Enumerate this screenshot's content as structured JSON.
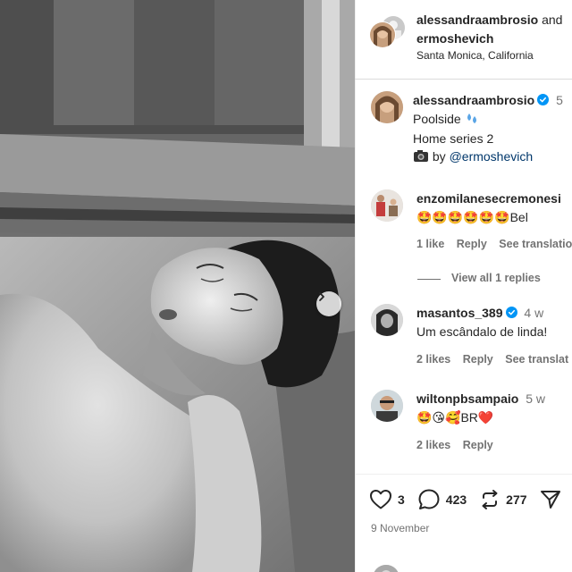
{
  "post": {
    "image_alt": "Black and white photo of a woman leaning back in a pool",
    "header": {
      "author": "alessandraambrosio",
      "author_suffix": "and",
      "collaborator": "ermoshevich",
      "location": "Santa Monica, California"
    },
    "caption": {
      "username": "alessandraambrosio",
      "time": "5",
      "line1": "Poolside",
      "line2": "Home series 2",
      "credit_prefix": "by",
      "credit_link": "@ermoshevich"
    },
    "comments": [
      {
        "username": "enzomilanesecremonesi",
        "text": "🤩🤩🤩🤩🤩🤩Bel",
        "likes": "1 like",
        "reply": "Reply",
        "translate": "See translation"
      },
      {
        "username": "masantos_389",
        "time": "4 w",
        "text": "Um escândalo de linda!",
        "likes": "2 likes",
        "reply": "Reply",
        "translate": "See translat"
      },
      {
        "username": "wiltonpbsampaio",
        "time": "5 w",
        "text": "🤩😘🥰BR❤️",
        "likes": "2 likes",
        "reply": "Reply"
      }
    ],
    "view_replies": "View all 1 replies",
    "actions": {
      "likes": "3",
      "comments": "423",
      "reposts": "277"
    },
    "date": "9 November"
  },
  "colors": {
    "verified": "#0095f6",
    "text": "#262626",
    "secondary": "#737373",
    "link": "#00376b",
    "heart_red": "#ed4956"
  }
}
